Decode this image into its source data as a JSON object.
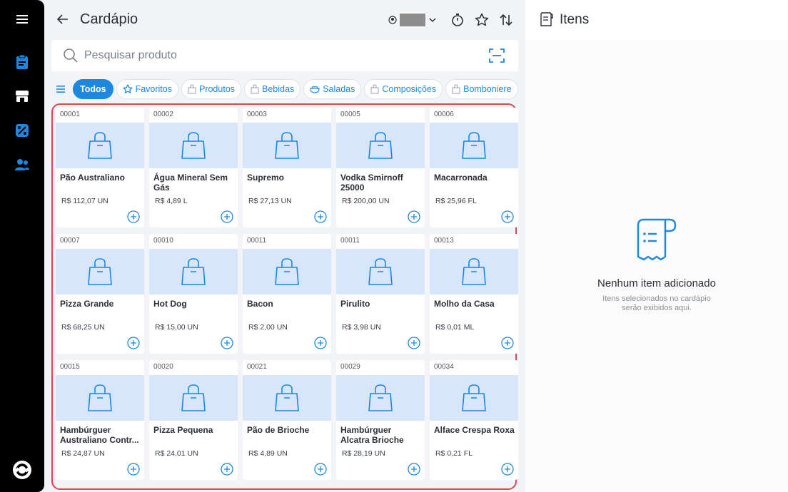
{
  "sidebar": {
    "items": [
      {
        "name": "menu-icon"
      },
      {
        "name": "clipboard-icon"
      },
      {
        "name": "store-icon"
      },
      {
        "name": "discount-icon"
      },
      {
        "name": "users-icon"
      }
    ],
    "logo": "brand-logo"
  },
  "header": {
    "title": "Cardápio"
  },
  "search": {
    "placeholder": "Pesquisar produto",
    "value": ""
  },
  "categories": [
    {
      "label": "Todos",
      "icon": "",
      "active": true
    },
    {
      "label": "Favoritos",
      "icon": "star-icon",
      "active": false
    },
    {
      "label": "Produtos",
      "icon": "bag-icon",
      "active": false
    },
    {
      "label": "Bebidas",
      "icon": "bag-icon",
      "active": false
    },
    {
      "label": "Saladas",
      "icon": "salad-icon",
      "active": false
    },
    {
      "label": "Composições",
      "icon": "bag-icon",
      "active": false
    },
    {
      "label": "Bomboniere",
      "icon": "bag-icon",
      "active": false
    }
  ],
  "products": [
    {
      "code": "00001",
      "name": "Pão Australiano",
      "price": "R$ 112,07 UN"
    },
    {
      "code": "00002",
      "name": "Água Mineral Sem Gás",
      "price": "R$ 4,89 L"
    },
    {
      "code": "00003",
      "name": "Supremo",
      "price": "R$ 27,13 UN"
    },
    {
      "code": "00005",
      "name": "Vodka Smirnoff 25000",
      "price": "R$ 200,00 UN"
    },
    {
      "code": "00006",
      "name": "Macarronada",
      "price": "R$ 25,96 FL"
    },
    {
      "code": "00007",
      "name": "Pizza Grande",
      "price": "R$ 68,25 UN"
    },
    {
      "code": "00010",
      "name": "Hot Dog",
      "price": "R$ 15,00 UN"
    },
    {
      "code": "00011",
      "name": "Bacon",
      "price": "R$ 2,00 UN"
    },
    {
      "code": "00011",
      "name": "Pirulito",
      "price": "R$ 3,98 UN"
    },
    {
      "code": "00013",
      "name": "Molho da Casa",
      "price": "R$ 0,01 ML"
    },
    {
      "code": "00015",
      "name": "Hambúrguer Australiano Contr...",
      "price": "R$ 24,87 UN"
    },
    {
      "code": "00020",
      "name": "Pizza Pequena",
      "price": "R$ 24,01 UN"
    },
    {
      "code": "00021",
      "name": "Pão de Brioche",
      "price": "R$ 4,89 UN"
    },
    {
      "code": "00029",
      "name": "Hambúrguer Alcatra Brioche",
      "price": "R$ 28,19 UN"
    },
    {
      "code": "00034",
      "name": "Alface Crespa Roxa",
      "price": "R$ 0,21 FL"
    }
  ],
  "items_panel": {
    "title": "Itens",
    "empty_title": "Nenhum item adicionado",
    "empty_subtitle": "Itens selecionados no cardápio serão exibidos aqui."
  },
  "colors": {
    "accent": "#1c88e0",
    "highlight_border": "#e0474c",
    "image_placeholder": "#d7e6fb",
    "sidebar_bg": "#000000"
  }
}
